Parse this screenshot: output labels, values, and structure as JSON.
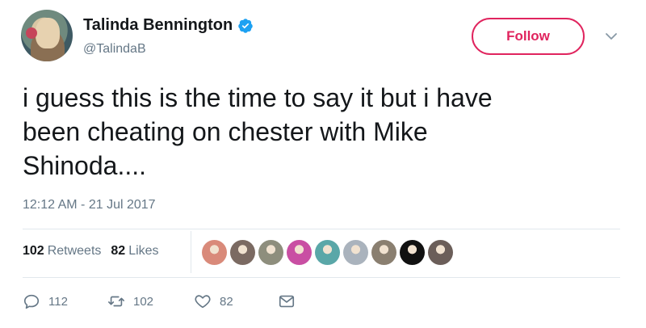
{
  "author": {
    "display_name": "Talinda Bennington",
    "handle": "@TalindaB",
    "verified_icon": "verified-badge-icon",
    "accent": "#1da1f2"
  },
  "follow_button": {
    "label": "Follow",
    "color": "#e0245e"
  },
  "tweet": {
    "lines": [
      "i guess this is the time to say it but i have",
      "been cheating on chester with Mike",
      "Shinoda...."
    ],
    "timestamp": "12:12 AM - 21 Jul 2017"
  },
  "stats": {
    "retweets_count": "102",
    "retweets_label": "Retweets",
    "likes_count": "82",
    "likes_label": "Likes"
  },
  "likers": [
    "#d98a7a",
    "#7b6a62",
    "#8e8e7d",
    "#c94fa3",
    "#5aa7a8",
    "#aab3bd",
    "#8a7f70",
    "#111111",
    "#6b5e59"
  ],
  "actions": {
    "reply_count": "112",
    "retweet_count": "102",
    "like_count": "82"
  }
}
